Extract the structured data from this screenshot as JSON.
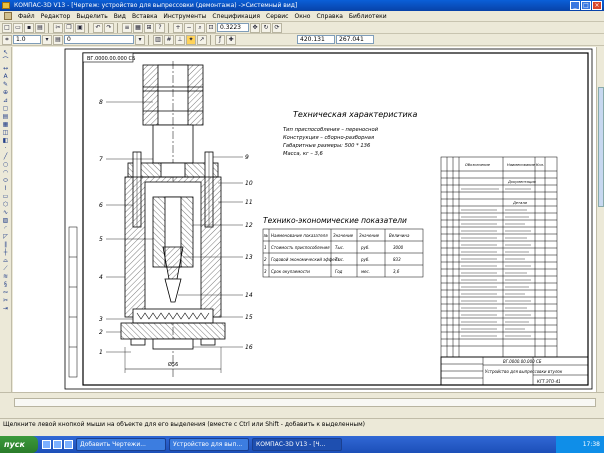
{
  "window": {
    "title": "КОМПАС-3D V13 - [Чертеж: устройство для выпрессовки (демонтажа) ->Системный вид]"
  },
  "menu": [
    "Файл",
    "Редактор",
    "Выделить",
    "Вид",
    "Вставка",
    "Инструменты",
    "Спецификация",
    "Сервис",
    "Окно",
    "Справка",
    "Библиотеки"
  ],
  "toolbar": {
    "scale": "1.0",
    "layer": "0",
    "zoom": "0.3223",
    "coord_x": "420.131",
    "coord_y": "267.041"
  },
  "drawing": {
    "stamp": "ВГ.0000.00.000 СБ",
    "tech_title": "Техническая характеристика",
    "tech_lines": [
      "Тип приспособления – переносной",
      "Конструкция – сборно-разборная",
      "Габаритные размеры: 500 * 136",
      "Масса, кг – 3,6"
    ],
    "econ_title": "Технико-экономические показатели",
    "econ_headers": [
      "№",
      "Наименование показателя",
      "Значение",
      "Значение",
      "Величина"
    ],
    "econ_rows": [
      [
        "1",
        "Стоимость приспособления",
        "Тыс.",
        "руб.",
        "3000"
      ],
      [
        "2",
        "Годовой экономический эффект",
        "Тыс.",
        "руб.",
        "833"
      ],
      [
        "3",
        "Срок окупаемости",
        "Год",
        "мес.",
        "3,6"
      ]
    ],
    "dim_label": "Ø56",
    "callouts": [
      "1",
      "2",
      "3",
      "4",
      "5",
      "6",
      "7",
      "8",
      "9",
      "10",
      "11",
      "12",
      "13",
      "14",
      "15",
      "16"
    ],
    "spec_header": [
      "Обозначение",
      "Наименование",
      "Кол."
    ],
    "spec_sections": [
      "Документация",
      "Детали"
    ],
    "title_block": {
      "code": "ВГ.0000.00.000 СБ",
      "name": "Устройство для выпрессовки втулок",
      "org": "КГТ ЭТО-41"
    }
  },
  "status": {
    "text": "Щелкните левой кнопкой мыши на объекте для его выделения (вместе с Ctrl или Shift - добавить к выделенным)"
  },
  "taskbar": {
    "start": "пуск",
    "tasks": [
      "Добавить Чертежи...",
      "Устройство для вып...",
      "КОМПАС-3D V13 - [Ч..."
    ],
    "clock": "17:38"
  }
}
